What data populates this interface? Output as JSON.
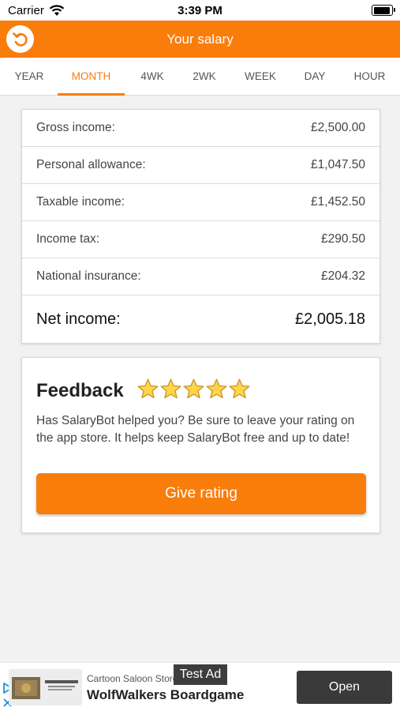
{
  "status_bar": {
    "carrier": "Carrier",
    "time": "3:39 PM"
  },
  "header": {
    "title": "Your salary",
    "back_icon": "undo-arrow-icon"
  },
  "tabs": [
    {
      "label": "YEAR"
    },
    {
      "label": "MONTH",
      "active": true
    },
    {
      "label": "4WK"
    },
    {
      "label": "2WK"
    },
    {
      "label": "WEEK"
    },
    {
      "label": "DAY"
    },
    {
      "label": "HOUR"
    }
  ],
  "income": {
    "rows": [
      {
        "label": "Gross income:",
        "value": "£2,500.00"
      },
      {
        "label": "Personal allowance:",
        "value": "£1,047.50"
      },
      {
        "label": "Taxable income:",
        "value": "£1,452.50"
      },
      {
        "label": "Income tax:",
        "value": "£290.50"
      },
      {
        "label": "National insurance:",
        "value": "£204.32"
      }
    ],
    "net": {
      "label": "Net income:",
      "value": "£2,005.18"
    }
  },
  "feedback": {
    "title": "Feedback",
    "stars": 5,
    "text": "Has SalaryBot helped you? Be sure to leave your rating on the app store. It helps keep SalaryBot free and up to date!",
    "button_label": "Give rating"
  },
  "ad": {
    "advertiser": "Cartoon Saloon Store",
    "badge": "Test Ad",
    "headline": "WolfWalkers Boardgame",
    "cta": "Open"
  },
  "colors": {
    "accent": "#f97d0b",
    "background": "#f2f2f2"
  }
}
